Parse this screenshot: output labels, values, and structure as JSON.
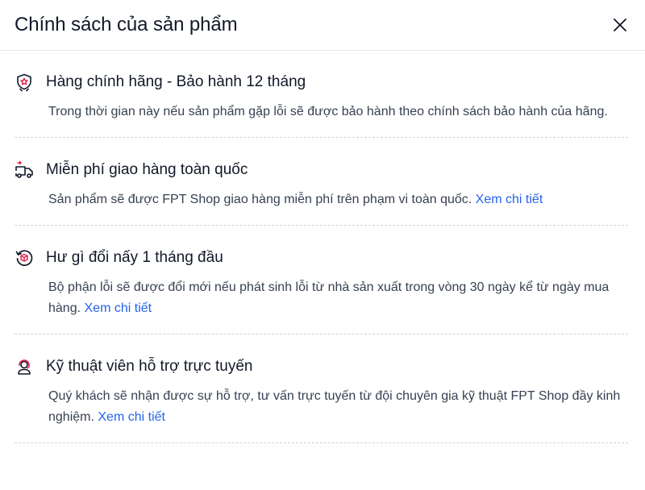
{
  "header": {
    "title": "Chính sách của sản phẩm"
  },
  "policies": [
    {
      "icon": "genuine-badge-icon",
      "title": "Hàng chính hãng - Bảo hành 12 tháng",
      "description": "Trong thời gian này nếu sản phẩm gặp lỗi sẽ được bảo hành theo chính sách bảo hành của hãng.",
      "link": ""
    },
    {
      "icon": "delivery-truck-icon",
      "title": "Miễn phí giao hàng toàn quốc",
      "description": "Sản phẩm sẽ được FPT Shop giao hàng miễn phí trên phạm vi toàn quốc.",
      "link": "Xem chi tiết"
    },
    {
      "icon": "exchange-box-icon",
      "title": "Hư gì đổi nấy 1 tháng đầu",
      "description": "Bộ phận lỗi sẽ được đổi mới nếu phát sinh lỗi từ nhà sản xuất trong vòng 30 ngày kể từ ngày mua hàng.",
      "link": "Xem chi tiết"
    },
    {
      "icon": "support-agent-icon",
      "title": "Kỹ thuật viên hỗ trợ trực tuyến",
      "description": "Quý khách sẽ nhận được sự hỗ trợ, tư vấn trực tuyến từ đội chuyên gia kỹ thuật FPT Shop đầy kinh nghiệm.",
      "link": "Xem chi tiết"
    }
  ],
  "colors": {
    "accent": "#e11d48",
    "link": "#2563eb",
    "text": "#111827"
  }
}
